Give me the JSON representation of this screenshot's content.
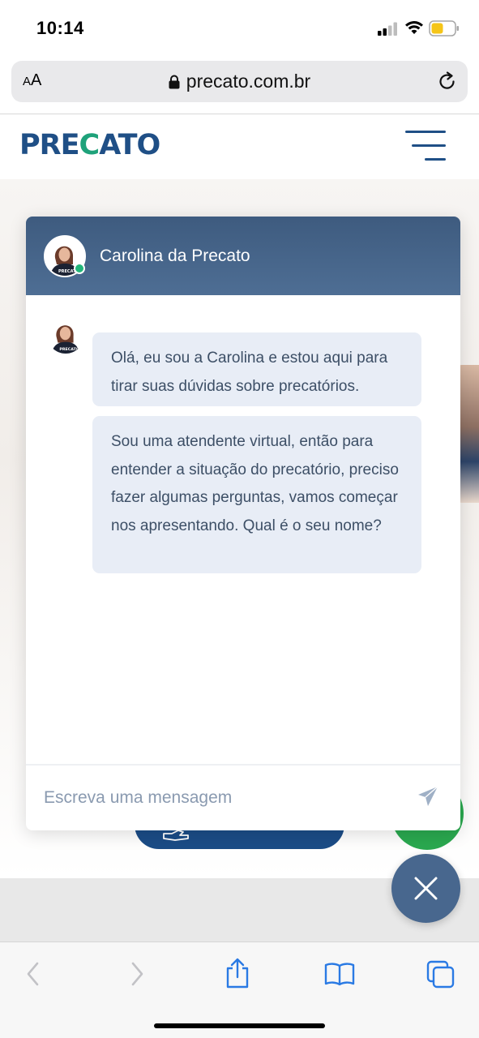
{
  "status_bar": {
    "time": "10:14"
  },
  "browser": {
    "text_size_label": "AA",
    "url": "precato.com.br"
  },
  "site": {
    "logo_text": "PRECATO",
    "brand_colors": {
      "primary": "#1f4f86",
      "accent": "#1ea27a"
    }
  },
  "chat": {
    "agent_name": "Carolina da Precato",
    "status": "online",
    "messages": [
      {
        "from": "agent",
        "text": "Olá, eu sou a Carolina e estou aqui para tirar suas dúvidas sobre precatórios."
      },
      {
        "from": "agent",
        "text": "Sou uma atendente virtual, então para entender a situação do precatório, preciso fazer algumas perguntas, vamos começar nos apresentando. Qual é o seu nome?"
      }
    ],
    "input_placeholder": "Escreva uma mensagem",
    "icons": {
      "send": "send-icon",
      "close": "close-icon"
    }
  },
  "toolbar": {
    "icons": [
      "back-icon",
      "forward-icon",
      "share-icon",
      "bookmarks-icon",
      "tabs-icon"
    ]
  }
}
